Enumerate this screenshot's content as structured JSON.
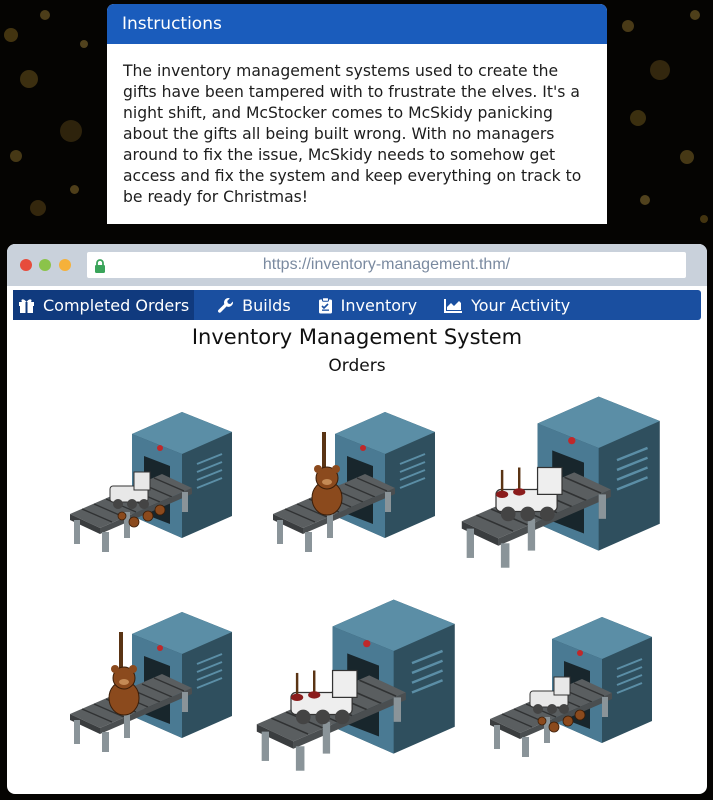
{
  "instructions": {
    "title": "Instructions",
    "body": "The inventory management systems used to create the gifts have been tampered with to frustrate the elves. It's a night shift, and McStocker comes to McSkidy panicking about the gifts all being built wrong. With no managers around to fix the issue, McSkidy needs to somehow get access and fix the system and keep everything on track to be ready for Christmas!"
  },
  "browser": {
    "url": "https://inventory-management.thm/",
    "dot_colors": [
      "#e74c3c",
      "#f1c40f",
      "#f39c12"
    ]
  },
  "nav": {
    "items": [
      {
        "label": "Completed Orders",
        "icon": "gift-icon"
      },
      {
        "label": "Builds",
        "icon": "wrench-icon"
      },
      {
        "label": "Inventory",
        "icon": "clipboard-icon"
      },
      {
        "label": "Your Activity",
        "icon": "chart-icon"
      }
    ]
  },
  "page": {
    "title": "Inventory Management System",
    "subtitle": "Orders"
  },
  "orders": [
    {
      "product": "toy-train-with-teddy-bears",
      "scale": "small"
    },
    {
      "product": "teddy-bear-with-plunger",
      "scale": "small"
    },
    {
      "product": "toy-train-with-plungers",
      "scale": "large"
    },
    {
      "product": "teddy-bear-with-plunger",
      "scale": "small"
    },
    {
      "product": "toy-train-with-plungers",
      "scale": "large"
    },
    {
      "product": "toy-train-with-teddy-bears",
      "scale": "small"
    }
  ],
  "colors": {
    "header_blue": "#1a5cbc",
    "nav_blue": "#1a4fa0",
    "machine_blue": "#4a7a93"
  }
}
